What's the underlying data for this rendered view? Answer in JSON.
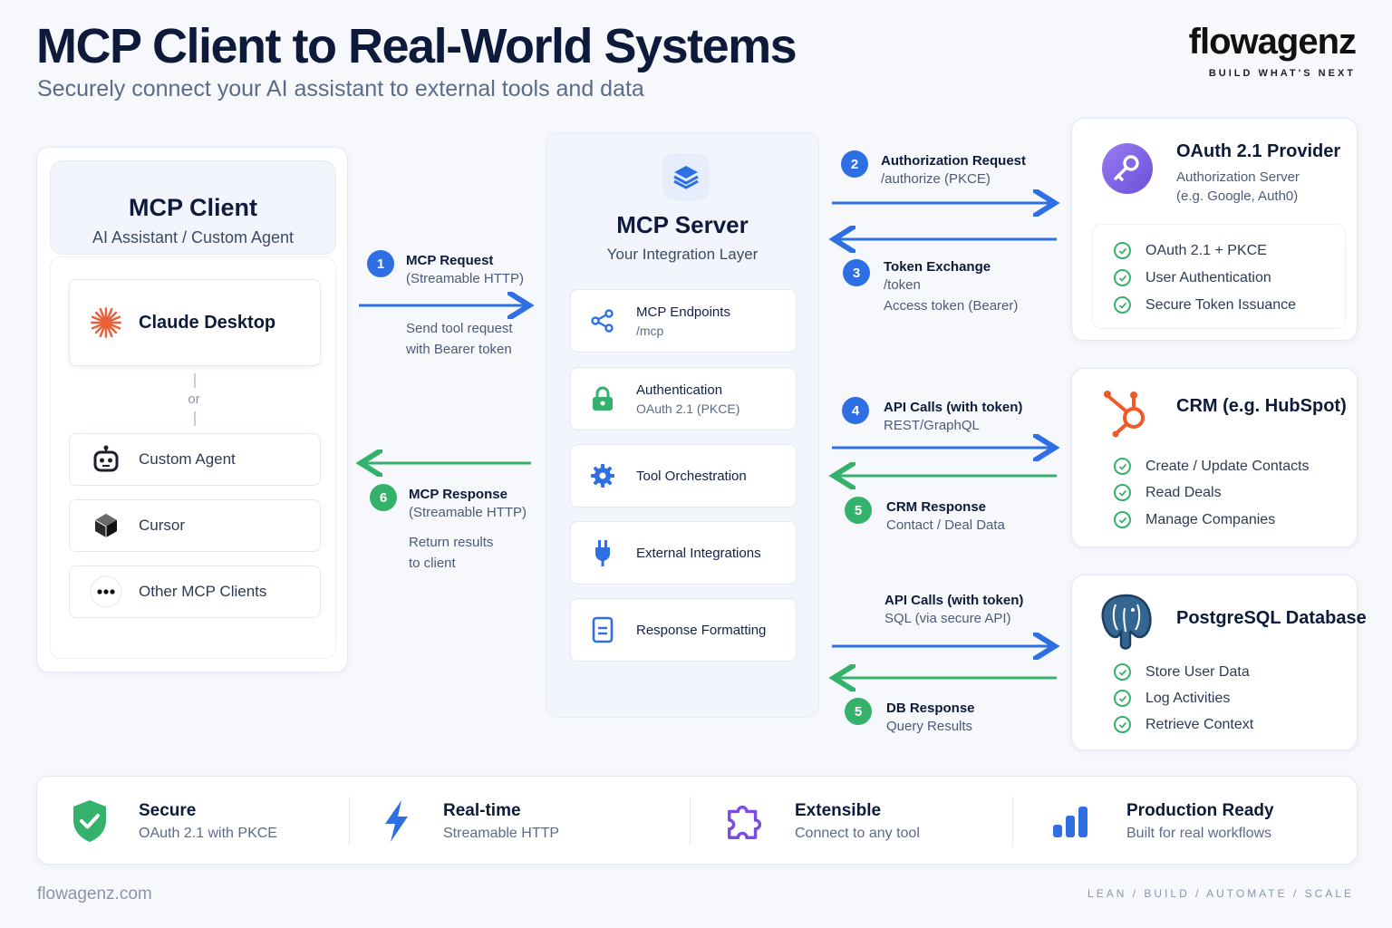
{
  "header": {
    "title": "MCP Client to Real-World Systems",
    "subtitle": "Securely connect your AI assistant to external tools and data",
    "brand": "flowagenz",
    "brand_tagline": "BUILD WHAT'S NEXT"
  },
  "client": {
    "title": "MCP Client",
    "subtitle": "AI Assistant / Custom Agent",
    "primary": "Claude Desktop",
    "or_label": "or",
    "items": [
      {
        "label": "Custom Agent",
        "icon": "robot-icon"
      },
      {
        "label": "Cursor",
        "icon": "cursor-cube-icon"
      },
      {
        "label": "Other MCP Clients",
        "icon": "ellipsis-icon"
      }
    ]
  },
  "server": {
    "title": "MCP Server",
    "subtitle": "Your Integration Layer",
    "items": [
      {
        "title": "MCP Endpoints",
        "sub": "/mcp",
        "icon": "share-icon"
      },
      {
        "title": "Authentication",
        "sub": "OAuth 2.1 (PKCE)",
        "icon": "lock-icon"
      },
      {
        "title": "Tool Orchestration",
        "sub": "",
        "icon": "gear-icon"
      },
      {
        "title": "External Integrations",
        "sub": "",
        "icon": "plug-icon"
      },
      {
        "title": "Response Formatting",
        "sub": "",
        "icon": "document-icon"
      }
    ]
  },
  "steps": {
    "s1": {
      "num": "1",
      "title": "MCP Request",
      "sub": "(Streamable HTTP)",
      "note1": "Send tool request",
      "note2": "with Bearer token"
    },
    "s6": {
      "num": "6",
      "title": "MCP Response",
      "sub": "(Streamable HTTP)",
      "note1": "Return results",
      "note2": "to client"
    },
    "s2": {
      "num": "2",
      "title": "Authorization Request",
      "sub": "/authorize (PKCE)"
    },
    "s3": {
      "num": "3",
      "title": "Token Exchange",
      "sub": "/token",
      "note": "Access token (Bearer)"
    },
    "s4": {
      "num": "4",
      "title": "API Calls (with token)",
      "sub": "REST/GraphQL"
    },
    "s5a": {
      "num": "5",
      "title": "CRM Response",
      "sub": "Contact / Deal Data"
    },
    "s4b": {
      "title": "API Calls (with token)",
      "sub": "SQL (via secure API)"
    },
    "s5b": {
      "num": "5",
      "title": "DB Response",
      "sub": "Query Results"
    }
  },
  "oauth": {
    "title": "OAuth 2.1 Provider",
    "sub1": "Authorization Server",
    "sub2": "(e.g. Google, Auth0)",
    "checks": [
      "OAuth 2.1 + PKCE",
      "User Authentication",
      "Secure Token Issuance"
    ]
  },
  "crm": {
    "title": "CRM (e.g. HubSpot)",
    "checks": [
      "Create / Update Contacts",
      "Read Deals",
      "Manage Companies"
    ]
  },
  "db": {
    "title": "PostgreSQL Database",
    "checks": [
      "Store User Data",
      "Log Activities",
      "Retrieve Context"
    ]
  },
  "features": [
    {
      "title": "Secure",
      "sub": "OAuth 2.1 with PKCE",
      "icon": "shield-check-icon"
    },
    {
      "title": "Real-time",
      "sub": "Streamable HTTP",
      "icon": "lightning-icon"
    },
    {
      "title": "Extensible",
      "sub": "Connect to any tool",
      "icon": "puzzle-icon"
    },
    {
      "title": "Production Ready",
      "sub": "Built for real workflows",
      "icon": "bar-chart-icon"
    }
  ],
  "footer": {
    "url": "flowagenz.com",
    "tagline": "LEAN  /  BUILD  /  AUTOMATE  /  SCALE"
  },
  "colors": {
    "request_arrow": "#2f6fe4",
    "response_arrow": "#34b26b",
    "accent_orange": "#e8613a",
    "check_green": "#34b26b"
  }
}
